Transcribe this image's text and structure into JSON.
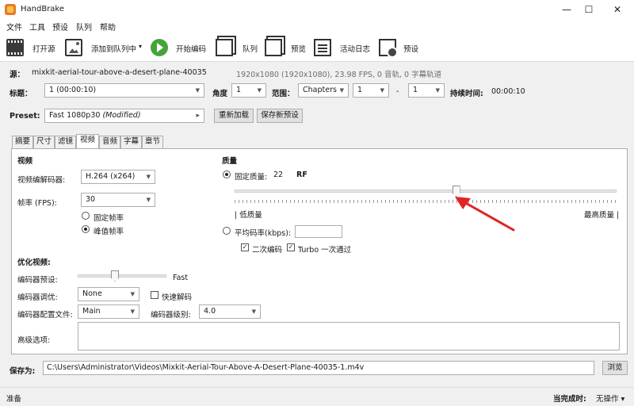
{
  "window": {
    "title": "HandBrake",
    "minimize": "—",
    "maximize": "☐",
    "close": "✕"
  },
  "menu": [
    "文件",
    "工具",
    "预设",
    "队列",
    "帮助"
  ],
  "toolbar": {
    "open_source": "打开源",
    "add_to_queue": "添加到队列中",
    "add_to_queue_chevron": "▾",
    "start_encode": "开始编码",
    "queue": "队列",
    "preview": "预览",
    "activity_log": "活动日志",
    "presets": "预设"
  },
  "source": {
    "label": "源：",
    "name": "mixkit-aerial-tour-above-a-desert-plane-40035",
    "info": "1920x1080 (1920x1080), 23.98 FPS, 0 音轨, 0 字幕轨道"
  },
  "title_row": {
    "title_label": "标题：",
    "title_value": "1  (00:00:10)",
    "angle_label": "角度",
    "angle_value": "1",
    "range_label": "范围：",
    "range_type": "Chapters",
    "range_start": "1",
    "range_dash": "-",
    "range_end": "1",
    "duration_label": "持续时间:",
    "duration_value": "00:00:10"
  },
  "preset": {
    "label": "Preset:",
    "value": "Fast 1080p30",
    "modified": "(Modified)",
    "arrow": "▸",
    "reload": "重新加载",
    "save_new": "保存新预设"
  },
  "tabs": [
    "摘要",
    "尺寸",
    "滤镜",
    "视频",
    "音频",
    "字幕",
    "章节"
  ],
  "active_tab": "视频",
  "video": {
    "section_label": "视频",
    "codec_label": "视频编解码器:",
    "codec_value": "H.264 (x264)",
    "fps_label": "帧率 (FPS):",
    "fps_value": "30",
    "constant_fps": "固定帧率",
    "peak_fps": "峰值帧率"
  },
  "quality": {
    "section_label": "质量",
    "constant_quality_label": "固定质量:",
    "rf_value": "22",
    "rf_unit": "RF",
    "rf_slider_position": 0.58,
    "low_label": "| 低质量",
    "high_label": "最高质量 |",
    "avg_bitrate_label": "平均码率(kbps):",
    "avg_bitrate_value": "",
    "two_pass_label": "二次编码",
    "turbo_label": "Turbo 一次通过",
    "check_mark": "✓"
  },
  "optimize": {
    "section_label": "优化视频:",
    "encoder_preset_label": "编码器预设:",
    "encoder_preset_value": "Fast",
    "encoder_preset_slider_position": 0.42,
    "tune_label": "编码器调优:",
    "tune_value": "None",
    "fast_decode_label": "快速解码",
    "profile_label": "编码器配置文件:",
    "profile_value": "Main",
    "level_label": "编码器级别:",
    "level_value": "4.0",
    "advanced_label": "高级选项:",
    "advanced_value": ""
  },
  "save": {
    "label": "保存为:",
    "path": "C:\\Users\\Administrator\\Videos\\Mixkit-Aerial-Tour-Above-A-Desert-Plane-40035-1.m4v",
    "browse": "浏览"
  },
  "status": {
    "left": "准备",
    "when_done_label": "当完成时:",
    "when_done_value": "无操作 ▾"
  },
  "colors": {
    "annotation_arrow": "#e02424",
    "play_green": "#45a33a"
  }
}
